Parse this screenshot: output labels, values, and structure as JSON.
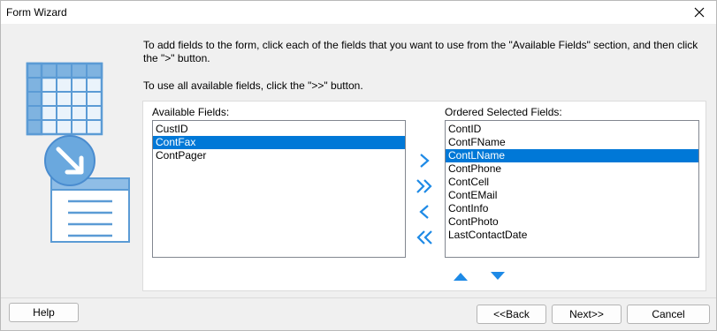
{
  "window": {
    "title": "Form Wizard"
  },
  "instructions": {
    "line1": "To add fields to the form, click each of the fields that you want to use  from the \"Available Fields\" section, and then click the \">\" button.",
    "line2": "To use all available fields, click the \">>\" button."
  },
  "available": {
    "label": "Available Fields:",
    "items": [
      "CustID",
      "ContFax",
      "ContPager"
    ],
    "selected_index": 1
  },
  "ordered": {
    "label": "Ordered Selected Fields:",
    "items": [
      "ContID",
      "ContFName",
      "ContLName",
      "ContPhone",
      "ContCell",
      "ContEMail",
      "ContInfo",
      "ContPhoto",
      "LastContactDate"
    ],
    "selected_index": 2
  },
  "icons": {
    "add": "chevron-right-icon",
    "add_all": "double-chevron-right-icon",
    "remove": "chevron-left-icon",
    "remove_all": "double-chevron-left-icon",
    "move_up": "triangle-up-icon",
    "move_down": "triangle-down-icon",
    "close": "close-icon"
  },
  "colors": {
    "accent": "#1e8ae6",
    "selection": "#0078d7",
    "illustration": "#5b9bd5"
  },
  "buttons": {
    "help": "Help",
    "back": "<<Back",
    "next": "Next>>",
    "cancel": "Cancel"
  }
}
